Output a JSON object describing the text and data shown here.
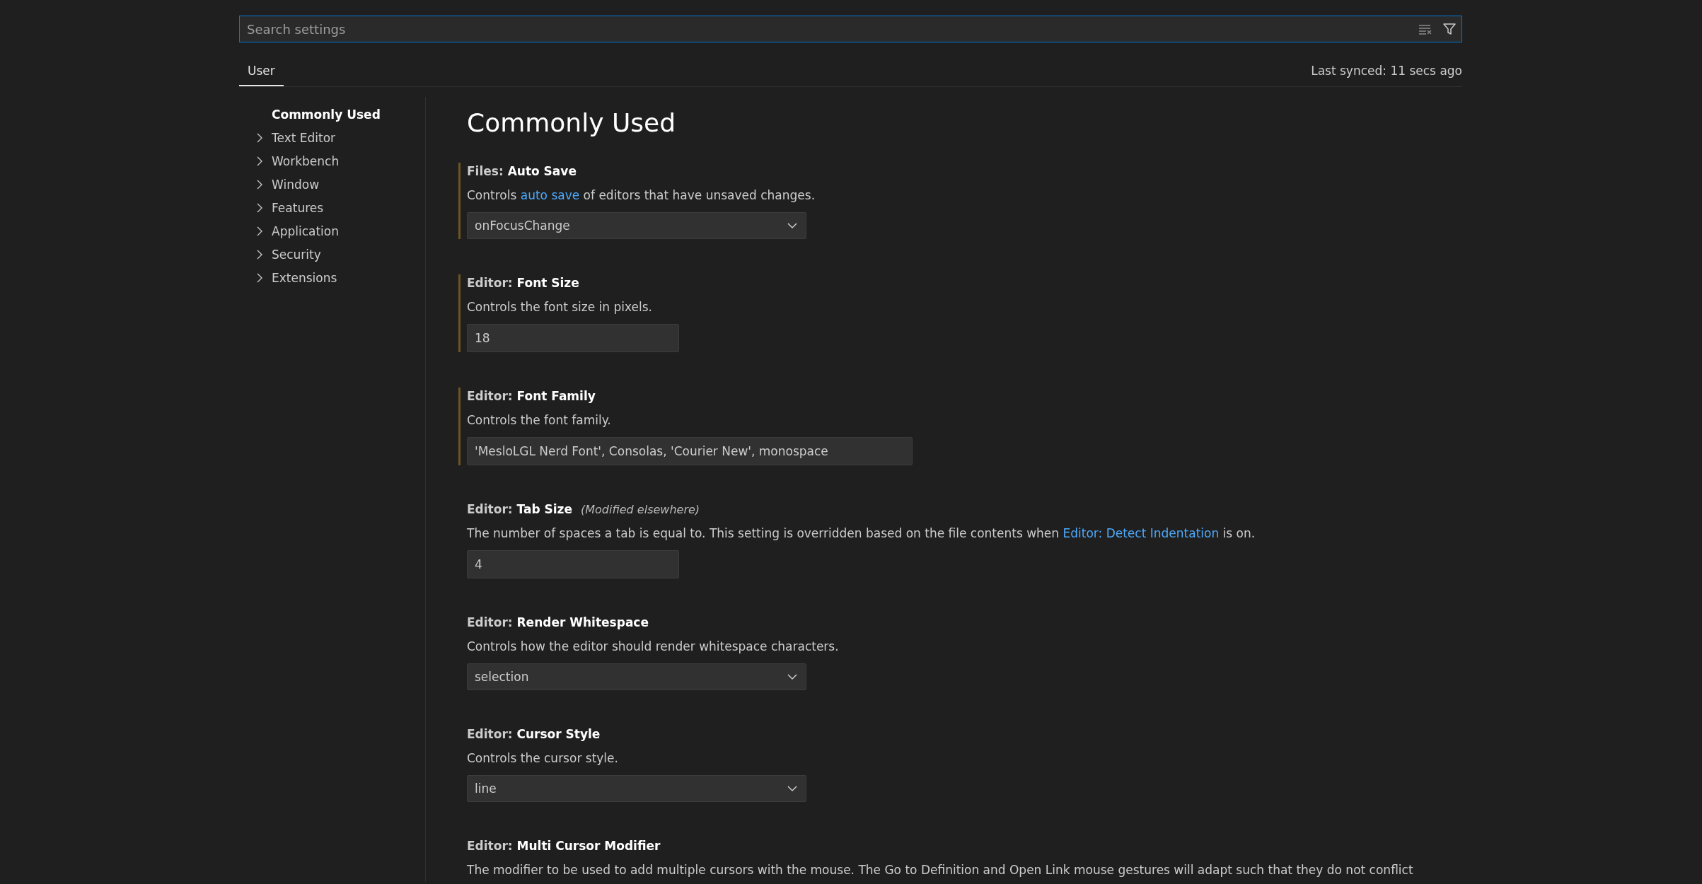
{
  "search": {
    "placeholder": "Search settings"
  },
  "tabs": [
    {
      "label": "User",
      "selected": true
    }
  ],
  "sync_status": "Last synced: 11 secs ago",
  "sidebar": {
    "items": [
      {
        "label": "Commonly Used",
        "selected": true,
        "expandable": false
      },
      {
        "label": "Text Editor",
        "selected": false,
        "expandable": true
      },
      {
        "label": "Workbench",
        "selected": false,
        "expandable": true
      },
      {
        "label": "Window",
        "selected": false,
        "expandable": true
      },
      {
        "label": "Features",
        "selected": false,
        "expandable": true
      },
      {
        "label": "Application",
        "selected": false,
        "expandable": true
      },
      {
        "label": "Security",
        "selected": false,
        "expandable": true
      },
      {
        "label": "Extensions",
        "selected": false,
        "expandable": true
      }
    ]
  },
  "heading": "Commonly Used",
  "settings": [
    {
      "category": "Files:",
      "name": "Auto Save",
      "modified": true,
      "description": [
        {
          "kind": "text",
          "text": "Controls "
        },
        {
          "kind": "link",
          "text": "auto save"
        },
        {
          "kind": "text",
          "text": " of editors that have unsaved changes."
        }
      ],
      "control": {
        "kind": "select",
        "value": "onFocusChange"
      }
    },
    {
      "category": "Editor:",
      "name": "Font Size",
      "modified": true,
      "description": [
        {
          "kind": "text",
          "text": "Controls the font size in pixels."
        }
      ],
      "control": {
        "kind": "text",
        "value": "18"
      }
    },
    {
      "category": "Editor:",
      "name": "Font Family",
      "modified": true,
      "description": [
        {
          "kind": "text",
          "text": "Controls the font family."
        }
      ],
      "control": {
        "kind": "wide-text",
        "value": "'MesloLGL Nerd Font', Consolas, 'Courier New', monospace"
      }
    },
    {
      "category": "Editor:",
      "name": "Tab Size",
      "modified": false,
      "note": "(Modified elsewhere)",
      "description": [
        {
          "kind": "text",
          "text": "The number of spaces a tab is equal to. This setting is overridden based on the file contents when "
        },
        {
          "kind": "link",
          "text": "Editor: Detect Indentation"
        },
        {
          "kind": "text",
          "text": " is on."
        }
      ],
      "control": {
        "kind": "text",
        "value": "4"
      }
    },
    {
      "category": "Editor:",
      "name": "Render Whitespace",
      "modified": false,
      "description": [
        {
          "kind": "text",
          "text": "Controls how the editor should render whitespace characters."
        }
      ],
      "control": {
        "kind": "select",
        "value": "selection"
      }
    },
    {
      "category": "Editor:",
      "name": "Cursor Style",
      "modified": false,
      "description": [
        {
          "kind": "text",
          "text": "Controls the cursor style."
        }
      ],
      "control": {
        "kind": "select",
        "value": "line"
      }
    },
    {
      "category": "Editor:",
      "name": "Multi Cursor Modifier",
      "modified": false,
      "description": [
        {
          "kind": "text",
          "text": "The modifier to be used to add multiple cursors with the mouse. The Go to Definition and Open Link mouse gestures will adapt such that they do not conflict"
        }
      ]
    }
  ]
}
